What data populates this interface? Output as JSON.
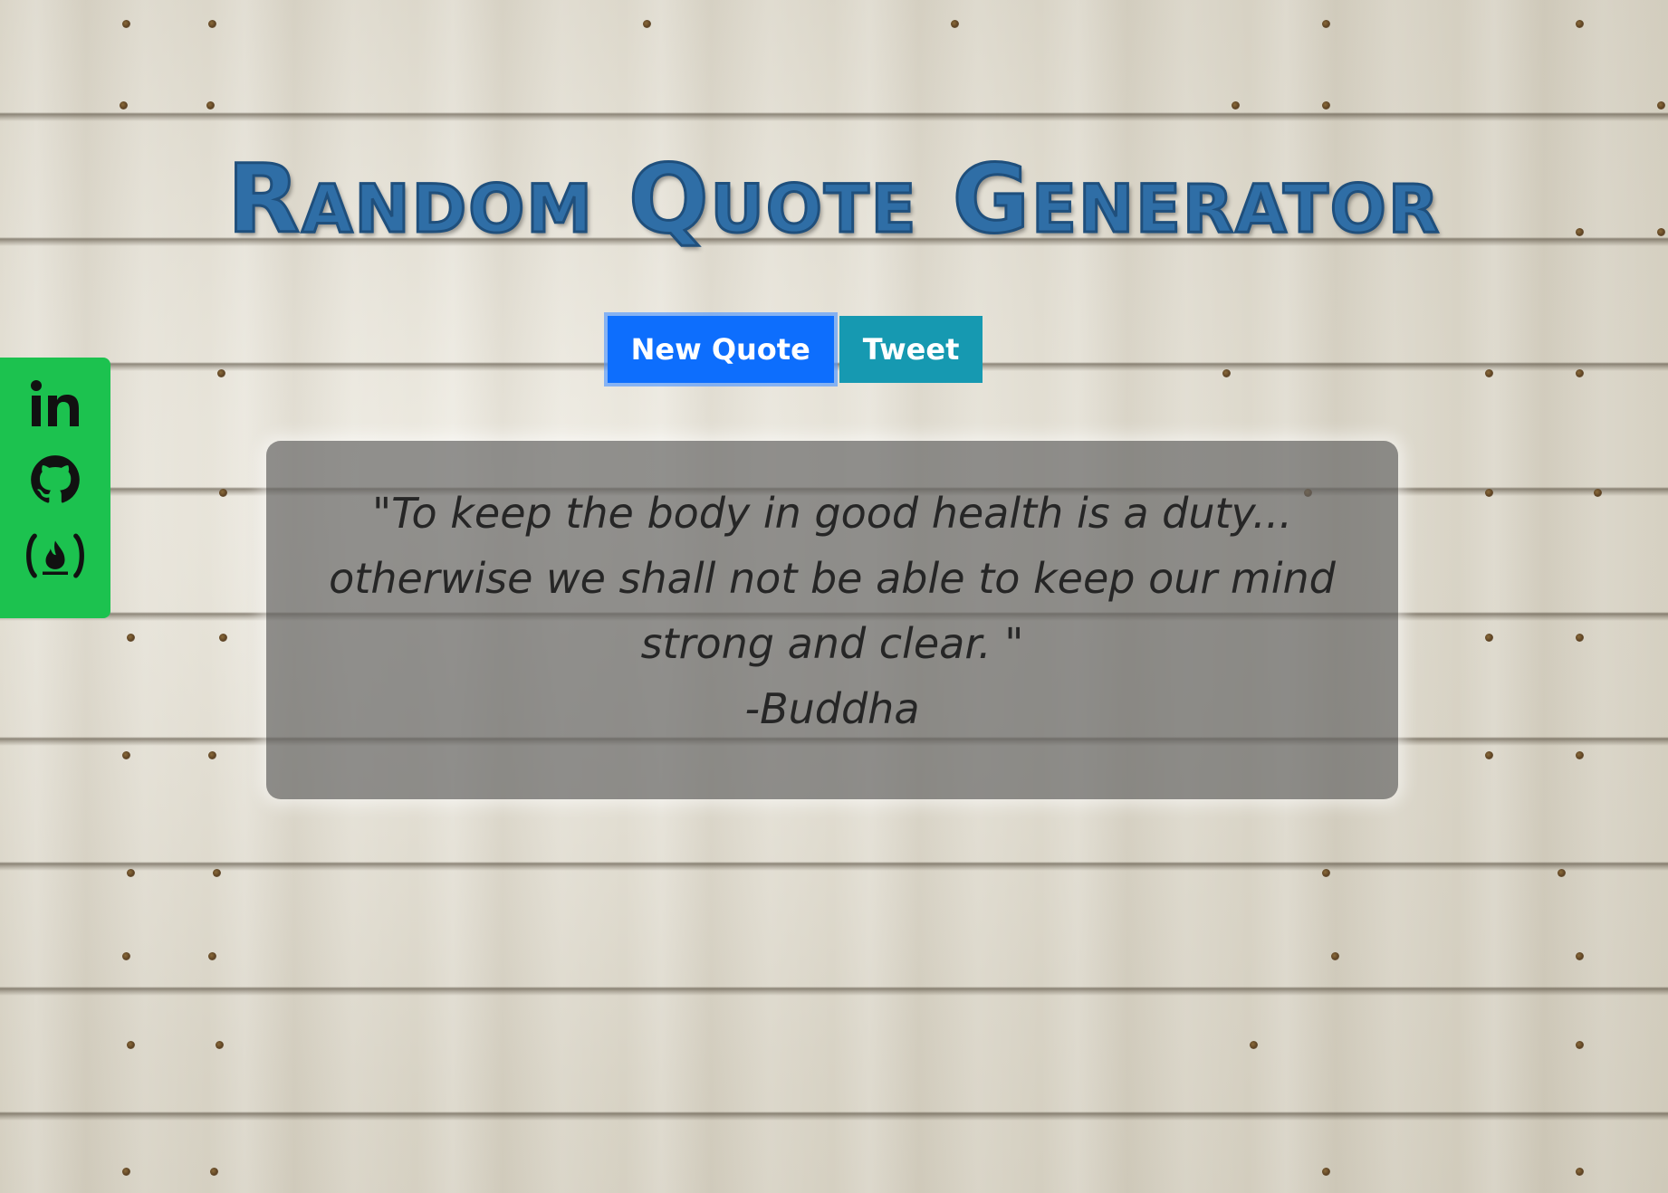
{
  "page": {
    "title": "Random Quote Generator"
  },
  "buttons": {
    "new_quote_label": "New Quote",
    "tweet_label": "Tweet"
  },
  "sidebar": {
    "icons": [
      "linkedin-icon",
      "github-icon",
      "freecodecamp-icon"
    ],
    "background": "#1cc24f"
  },
  "quote": {
    "text": "\"To keep the body in good health is a duty... otherwise we shall not be able to keep our mind strong and clear. \"",
    "author": "-Buddha"
  },
  "colors": {
    "title": "#2f6ea6",
    "new_quote_button": "#0d6efd",
    "tweet_button": "#1699b1"
  }
}
